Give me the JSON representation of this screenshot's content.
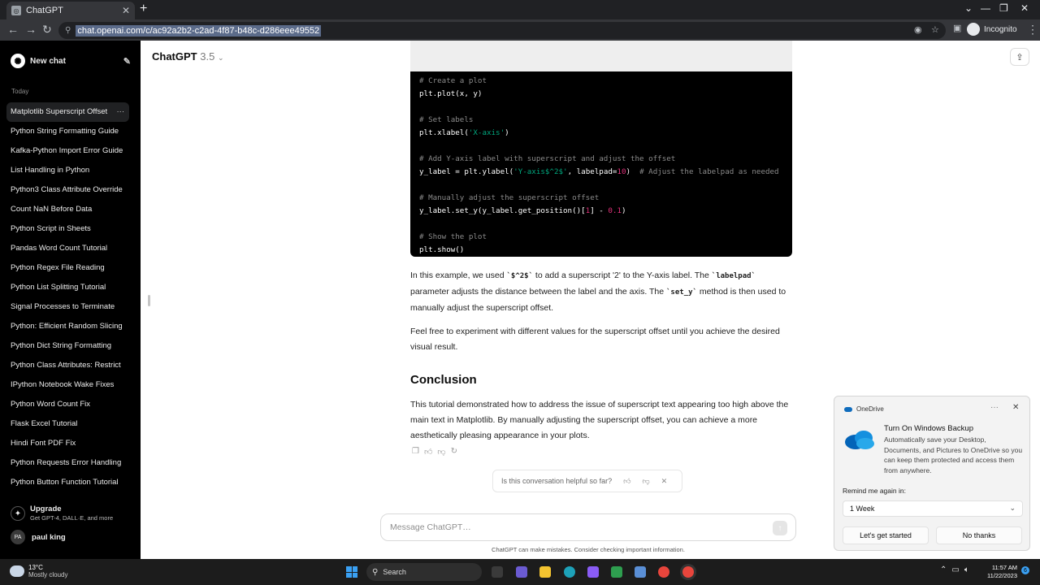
{
  "browser": {
    "tab_title": "ChatGPT",
    "url": "chat.openai.com/c/ac92a2b2-c2ad-4f87-b48c-d286eee49552",
    "profile_label": "Incognito"
  },
  "sidebar": {
    "new_chat": "New chat",
    "section_label": "Today",
    "history": [
      {
        "label": "Matplotlib Superscript Offset"
      },
      {
        "label": "Python String Formatting Guide"
      },
      {
        "label": "Kafka-Python Import Error Guide"
      },
      {
        "label": "List Handling in Python"
      },
      {
        "label": "Python3 Class Attribute Override"
      },
      {
        "label": "Count NaN Before Data"
      },
      {
        "label": "Python Script in Sheets"
      },
      {
        "label": "Pandas Word Count Tutorial"
      },
      {
        "label": "Python Regex File Reading"
      },
      {
        "label": "Python List Splitting Tutorial"
      },
      {
        "label": "Signal Processes to Terminate"
      },
      {
        "label": "Python: Efficient Random Slicing"
      },
      {
        "label": "Python Dict String Formatting"
      },
      {
        "label": "Python Class Attributes: Restrict"
      },
      {
        "label": "IPython Notebook Wake Fixes"
      },
      {
        "label": "Python Word Count Fix"
      },
      {
        "label": "Flask Excel Tutorial"
      },
      {
        "label": "Hindi Font PDF Fix"
      },
      {
        "label": "Python Requests Error Handling"
      },
      {
        "label": "Python Button Function Tutorial"
      }
    ],
    "upgrade_title": "Upgrade",
    "upgrade_sub": "Get GPT-4, DALL·E, and more",
    "user_initials": "PA",
    "user_name": "paul king"
  },
  "header": {
    "model_name": "ChatGPT",
    "model_version": "3.5"
  },
  "code_lines": [
    [
      {
        "t": "# Create a plot",
        "c": "cm"
      }
    ],
    [
      {
        "t": "plt.plot(x, y)",
        "c": "pl"
      }
    ],
    [],
    [
      {
        "t": "# Set labels",
        "c": "cm"
      }
    ],
    [
      {
        "t": "plt.xlabel(",
        "c": "pl"
      },
      {
        "t": "'X-axis'",
        "c": "st"
      },
      {
        "t": ")",
        "c": "pl"
      }
    ],
    [],
    [
      {
        "t": "# Add Y-axis label with superscript and adjust the offset",
        "c": "cm"
      }
    ],
    [
      {
        "t": "y_label = plt.ylabel(",
        "c": "pl"
      },
      {
        "t": "'Y-axis$^2$'",
        "c": "st"
      },
      {
        "t": ", labelpad=",
        "c": "pl"
      },
      {
        "t": "10",
        "c": "nm"
      },
      {
        "t": ")  ",
        "c": "pl"
      },
      {
        "t": "# Adjust the labelpad as needed",
        "c": "cm"
      }
    ],
    [],
    [
      {
        "t": "# Manually adjust the superscript offset",
        "c": "cm"
      }
    ],
    [
      {
        "t": "y_label.set_y(y_label.get_position()[",
        "c": "pl"
      },
      {
        "t": "1",
        "c": "nm"
      },
      {
        "t": "] - ",
        "c": "pl"
      },
      {
        "t": "0.1",
        "c": "nm"
      },
      {
        "t": ")",
        "c": "pl"
      }
    ],
    [],
    [
      {
        "t": "# Show the plot",
        "c": "cm"
      }
    ],
    [
      {
        "t": "plt.show()",
        "c": "pl"
      }
    ]
  ],
  "content": {
    "p1_a": "In this example, we used ",
    "p1_code1": "`$^2$`",
    "p1_b": " to add a superscript '2' to the Y-axis label. The ",
    "p1_code2": "`labelpad`",
    "p1_c": " parameter adjusts the distance between the label and the axis. The ",
    "p1_code3": "`set_y`",
    "p1_d": " method is then used to manually adjust the superscript offset.",
    "p2": "Feel free to experiment with different values for the superscript offset until you achieve the desired visual result.",
    "conclusion_heading": "Conclusion",
    "p3": "This tutorial demonstrated how to address the issue of superscript text appearing too high above the main text in Matplotlib. By manually adjusting the superscript offset, you can achieve a more aesthetically pleasing appearance in your plots."
  },
  "feedback": {
    "question": "Is this conversation helpful so far?"
  },
  "composer": {
    "placeholder": "Message ChatGPT…",
    "disclaimer": "ChatGPT can make mistakes. Consider checking important information."
  },
  "onedrive": {
    "app_name": "OneDrive",
    "title": "Turn On Windows Backup",
    "description": "Automatically save your Desktop, Documents, and Pictures to OneDrive so you can keep them protected and access them from anywhere.",
    "remind_label": "Remind me again in:",
    "remind_value": "1 Week",
    "primary_button": "Let's get started",
    "secondary_button": "No thanks"
  },
  "taskbar": {
    "temp": "13°C",
    "weather": "Mostly cloudy",
    "search_label": "Search",
    "time": "11:57 AM",
    "date": "11/22/2023",
    "notification_count": "6"
  },
  "colors": {
    "sidebar_bg": "#000000",
    "code_comment": "#8a8a8a",
    "code_string": "#00a67d",
    "code_number": "#df3079",
    "onedrive_blue": "#0f6cbd"
  }
}
